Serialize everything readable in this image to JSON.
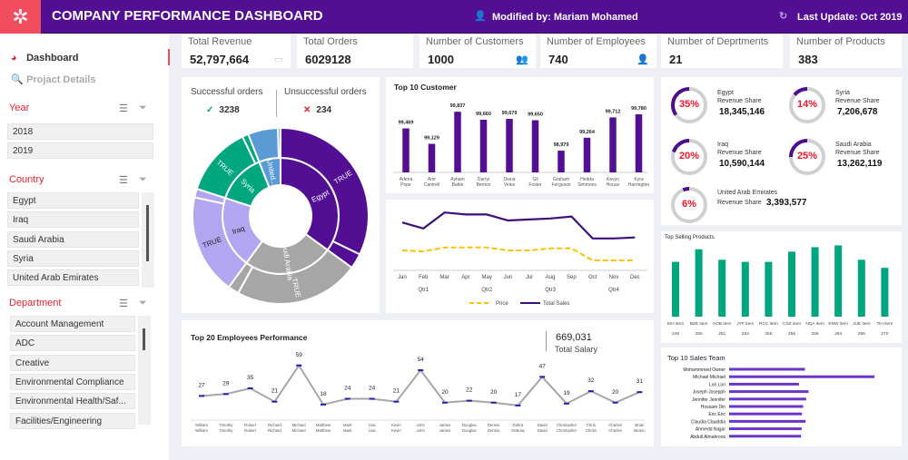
{
  "header": {
    "title": "COMPANY PERFORMANCE DASHBOARD",
    "modified": "Modified by: Mariam Mohamed",
    "last_update": "Last Update: Oct 2019",
    "logo_icon": "network-icon",
    "accent": "#520f94",
    "logo_color": "#f04e5e"
  },
  "nav": [
    {
      "label": "Dashboard",
      "icon": "pie-chart-icon",
      "active": true
    },
    {
      "label": "Projact Details",
      "icon": "search-chart-icon",
      "active": false
    }
  ],
  "slicers": {
    "year": {
      "title": "Year",
      "items": [
        "2018",
        "2019"
      ]
    },
    "country": {
      "title": "Country",
      "items": [
        "Egypt",
        "Iraq",
        "Saudi Arabia",
        "Syria",
        "United Arab Emirates"
      ]
    },
    "department": {
      "title": "Department",
      "items": [
        "Account Management",
        "ADC",
        "Creative",
        "Environmental Compliance",
        "Environmental Health/Saf...",
        "Facilities/Engineering"
      ]
    }
  },
  "kpis": [
    {
      "label": "Total Revenue",
      "value": "52,797,664",
      "icon": "cash-register-icon"
    },
    {
      "label": "Total Orders",
      "value": "6029128",
      "icon": ""
    },
    {
      "label": "Number of Customers",
      "value": "1000",
      "icon": "users-icon"
    },
    {
      "label": "Number of Employees",
      "value": "740",
      "icon": "user-icon"
    },
    {
      "label": "Number of Deprtments",
      "value": "21",
      "icon": ""
    },
    {
      "label": "Number of Products",
      "value": "383",
      "icon": ""
    }
  ],
  "orders": {
    "success_label": "Successful orders",
    "success_value": "3238",
    "fail_label": "Unsuccessful orders",
    "fail_value": "234"
  },
  "chart_data": [
    {
      "type": "sunburst",
      "inner": [
        {
          "name": "Egypt",
          "share": 35,
          "color": "#520f94"
        },
        {
          "name": "Saudi Arabia",
          "share": 25,
          "color": "#a6a6a6"
        },
        {
          "name": "Iraq",
          "share": 20,
          "color": "#b3a6f0"
        },
        {
          "name": "Syria",
          "share": 14,
          "color": "#00a67e"
        },
        {
          "name": "United...",
          "share": 6,
          "color": "#5b9bd5"
        }
      ],
      "outer_label": "TRUE"
    },
    {
      "type": "bar",
      "title": "Top 10 Customer",
      "categories": [
        "Adena Pope",
        "Amr Cantrell",
        "Ayham Battle",
        "Darryl Benton",
        "Diana Velez",
        "Gil Foster",
        "Graham Ferguson",
        "Hedda Simmons",
        "Kevyn House",
        "Kyra Harrington"
      ],
      "values": [
        99469,
        99129,
        99837,
        99660,
        99679,
        99650,
        98979,
        99264,
        99712,
        99780
      ],
      "labels": [
        "99,469",
        "99,129",
        "99,837",
        "99,660",
        "99,679",
        "99,650",
        "98,979",
        "99,264",
        "99,712",
        "99,780"
      ],
      "color": "#520f94"
    },
    {
      "type": "line",
      "categories": [
        "Jan",
        "Feb",
        "Mar",
        "Apr",
        "May",
        "Jun",
        "Jul",
        "Aug",
        "Sep",
        "Oct",
        "Nov",
        "Dec"
      ],
      "quarters": [
        "Qtr1",
        "Qtr2",
        "Qtr3",
        "Qtr4"
      ],
      "series": [
        {
          "name": "Price",
          "values": [
            40,
            39,
            43,
            43,
            43,
            40,
            40,
            42,
            42,
            30,
            30,
            30
          ],
          "color": "#ffc000"
        },
        {
          "name": "Total Sales",
          "values": [
            68,
            62,
            78,
            76,
            76,
            70,
            71,
            72,
            74,
            52,
            52,
            53
          ],
          "color": "#3d0f7a"
        }
      ]
    },
    {
      "type": "line",
      "title": "Top 20 Employees Performance",
      "categories": [
        "William William",
        "Timothy Timothy",
        "Robert Robert",
        "Richard Richard",
        "Michael Michael",
        "Matthew Matthew",
        "Mark Mark",
        "Lisa Lisa",
        "Kevin Kevin",
        "John John",
        "James James",
        "Douglas Douglas",
        "Dennis Dennis",
        "Debra Debraa",
        "David David",
        "Christopher Christopher",
        "Chris Chriss",
        "Charles Charles",
        "Brian Briann"
      ],
      "values": [
        27,
        29,
        35,
        21,
        59,
        18,
        24,
        24,
        21,
        54,
        20,
        22,
        20,
        17,
        47,
        19,
        32,
        20,
        31
      ],
      "color": "#a6a6a6",
      "marker": "#1f1fb4"
    },
    {
      "type": "bar",
      "title": "Top Selling Products",
      "categories": [
        "EiH item",
        "BZE item",
        "AOB item",
        "JYF item",
        "RCC item",
        "CSZ item",
        "NQA item",
        "ENW item",
        "JUE item",
        "TiH item"
      ],
      "sublabels": [
        "249",
        "250",
        "251",
        "253",
        "255",
        "256",
        "258",
        "264",
        "268",
        "270"
      ],
      "values": [
        183,
        225,
        190,
        183,
        183,
        217,
        232,
        238,
        190,
        163
      ],
      "color": "#00a67e"
    },
    {
      "type": "bar",
      "orientation": "horizontal",
      "title": "Top 10 Sales Team",
      "categories": [
        "Mohammmed Owner",
        "Michael Michael",
        "Lori Lori",
        "Joseph Josepph",
        "Jennifer Jennifer",
        "Hossam Din",
        "Eric Eric",
        "Claudia Clauddia",
        "Ahmedd Najjar",
        "Abdull Almahroos"
      ],
      "values": [
        253,
        485,
        233,
        265,
        257,
        247,
        243,
        255,
        242,
        240
      ],
      "color": "#6b35c9"
    }
  ],
  "revenue_share": {
    "label": "Revenue Share",
    "items": [
      {
        "country": "Egypt",
        "pct": "35%",
        "share": 35,
        "value": "18,345,146"
      },
      {
        "country": "Syria",
        "pct": "14%",
        "share": 14,
        "value": "7,206,678"
      },
      {
        "country": "Iraq",
        "pct": "20%",
        "share": 20,
        "value": "10,590,144"
      },
      {
        "country": "Saudi Arabia",
        "pct": "25%",
        "share": 25,
        "value": "13,262,119"
      },
      {
        "country": "United Arab Emirates",
        "pct": "6%",
        "share": 6,
        "value": "3,393,577"
      }
    ]
  },
  "salary": {
    "value": "669,031",
    "label": "Total Salary"
  }
}
